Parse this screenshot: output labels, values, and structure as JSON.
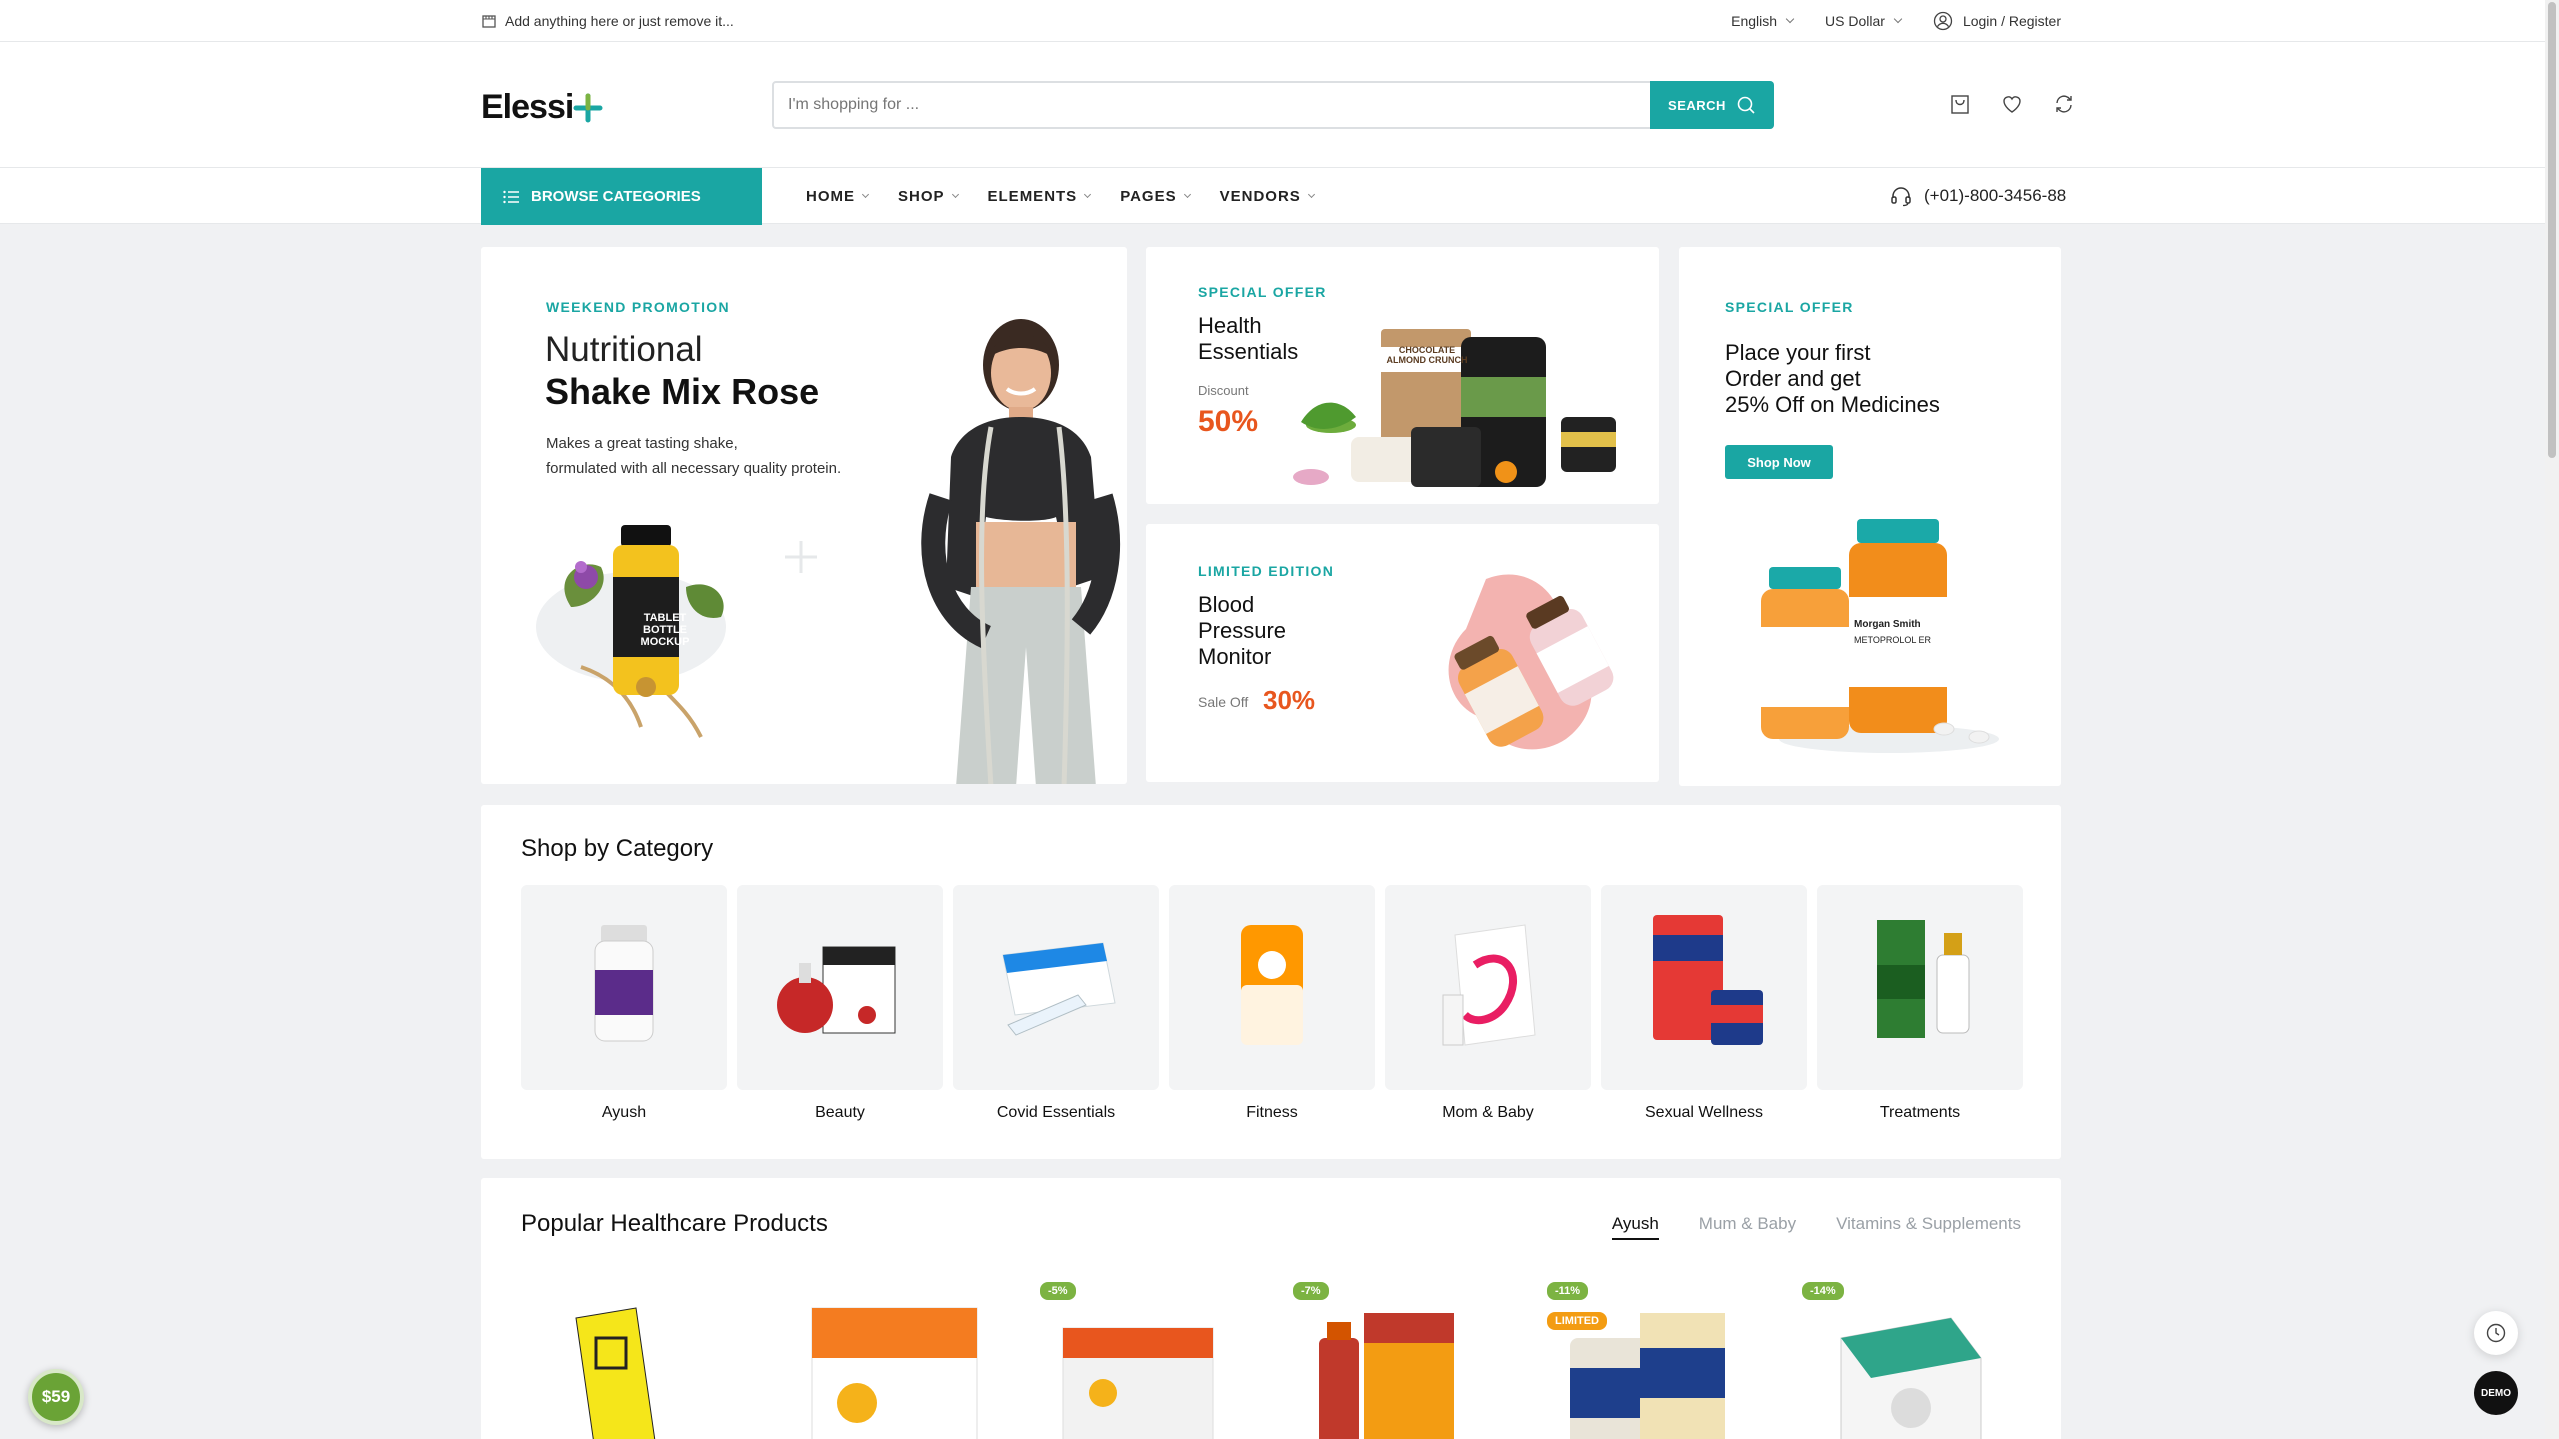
{
  "topbar": {
    "note": "Add anything here or just remove it...",
    "language": "English",
    "currency": "US Dollar",
    "login": "Login / Register"
  },
  "header": {
    "logo": "Elessi",
    "search_placeholder": "I'm shopping for ...",
    "search_button": "SEARCH"
  },
  "nav": {
    "browse": "BROWSE CATEGORIES",
    "items": [
      "HOME",
      "SHOP",
      "ELEMENTS",
      "PAGES",
      "VENDORS"
    ],
    "phone": "(+01)-800-3456-88"
  },
  "promo_main": {
    "label": "WEEKEND PROMOTION",
    "title_light": "Nutritional",
    "title_bold": "Shake Mix Rose",
    "desc1": "Makes a great tasting shake,",
    "desc2": "formulated with all necessary quality protein.",
    "bottle_text1": "TABLET",
    "bottle_text2": "BOTTLE",
    "bottle_text3": "MOCKUP"
  },
  "promo_health": {
    "label": "SPECIAL OFFER",
    "title1": "Health",
    "title2": "Essentials",
    "sub": "Discount",
    "value": "50%",
    "pack": "CHOCOLATE ALMOND CRUNCH"
  },
  "promo_blood": {
    "label": "LIMITED EDITION",
    "title1": "Blood",
    "title2": "Pressure",
    "title3": "Monitor",
    "sub": "Sale Off",
    "value": "30%"
  },
  "promo_medicine": {
    "label": "SPECIAL OFFER",
    "line1": "Place your first",
    "line2": "Order and get",
    "line3": "25% Off on Medicines",
    "button": "Shop Now",
    "bottle_label1": "Morgan Smith",
    "bottle_label2": "METOPROLOL ER"
  },
  "categories": {
    "title": "Shop by Category",
    "items": [
      "Ayush",
      "Beauty",
      "Covid Essentials",
      "Fitness",
      "Mom & Baby",
      "Sexual Wellness",
      "Treatments"
    ]
  },
  "popular": {
    "title": "Popular Healthcare Products",
    "tabs": [
      "Ayush",
      "Mum & Baby",
      "Vitamins & Supplements"
    ],
    "badges": [
      "-5%",
      "-7%",
      "-11%",
      "-14%"
    ],
    "limited": "LIMITED"
  },
  "floating": {
    "price": "$59",
    "demo": "DEMO"
  },
  "colors": {
    "accent": "#1aa6a3",
    "sale": "#e8561e",
    "badge": "#7cb342"
  }
}
